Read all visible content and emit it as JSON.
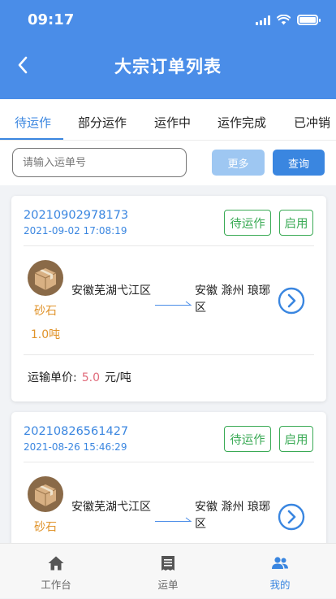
{
  "status_bar": {
    "time": "09:17"
  },
  "header": {
    "title": "大宗订单列表"
  },
  "tabs": [
    {
      "label": "待运作",
      "active": true
    },
    {
      "label": "部分运作",
      "active": false
    },
    {
      "label": "运作中",
      "active": false
    },
    {
      "label": "运作完成",
      "active": false
    },
    {
      "label": "已冲销",
      "active": false
    }
  ],
  "search": {
    "placeholder": "请输入运单号",
    "value": "",
    "more_label": "更多",
    "query_label": "查询"
  },
  "orders": [
    {
      "order_no": "20210902978173",
      "time": "2021-09-02 17:08:19",
      "status_tag": "待运作",
      "enable_tag": "启用",
      "goods_name": "砂石",
      "goods_qty": "1.0吨",
      "from": "安徽芜湖弋江区",
      "to": "安徽 滁州 琅琊区",
      "price_label": "运输单价:",
      "price_value": "5.0",
      "price_unit": "元/吨"
    },
    {
      "order_no": "20210826561427",
      "time": "2021-08-26 15:46:29",
      "status_tag": "待运作",
      "enable_tag": "启用",
      "goods_name": "砂石",
      "from": "安徽芜湖弋江区",
      "to": "安徽 滁州 琅琊区"
    }
  ],
  "tabbar": [
    {
      "label": "工作台",
      "icon": "home-icon",
      "active": false
    },
    {
      "label": "运单",
      "icon": "receipt-icon",
      "active": false
    },
    {
      "label": "我的",
      "icon": "users-icon",
      "active": true
    }
  ],
  "colors": {
    "primary": "#3a86e0",
    "header_bg": "#4a8de8",
    "tag_green": "#3aaa55",
    "goods_orange": "#e0932a",
    "price_red": "#e06a7a"
  }
}
